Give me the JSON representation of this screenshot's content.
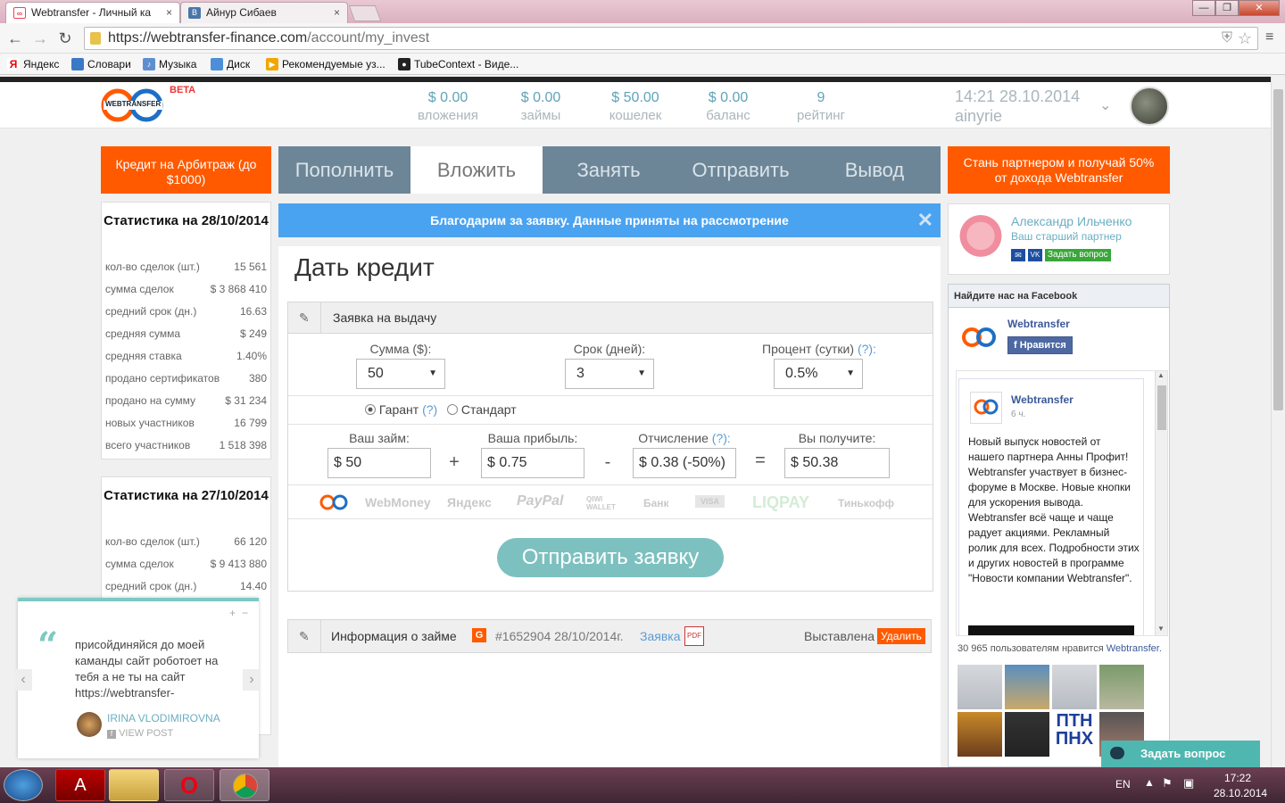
{
  "browser": {
    "tabs": [
      {
        "label": "Webtransfer - Личный ка",
        "close": "×"
      },
      {
        "label": "Айнур Сибаев",
        "close": "×"
      }
    ],
    "url_host": "https://webtransfer-finance.com",
    "url_path": "/account/my_invest",
    "bookmarks": [
      "Яндекс",
      "Словари",
      "Музыка",
      "Диск",
      "Рекомендуемые уз...",
      "TubeContext - Виде..."
    ],
    "window_buttons": [
      "—",
      "❐",
      "✕"
    ]
  },
  "header": {
    "logo_text": "WEBTRANSFER",
    "beta": "BETA",
    "stats": [
      {
        "value": "$ 0.00",
        "label": "вложения"
      },
      {
        "value": "$ 0.00",
        "label": "займы"
      },
      {
        "value": "$ 50.00",
        "label": "кошелек"
      },
      {
        "value": "$ 0.00",
        "label": "баланс"
      },
      {
        "value": "9",
        "label": "рейтинг"
      }
    ],
    "datetime": "14:21 28.10.2014",
    "username": "ainyrie"
  },
  "left": {
    "promo": "Кредит на Арбитраж (до $1000)",
    "stats_1": {
      "title": "Статистика на 28/10/2014",
      "rows": [
        {
          "label": "кол-во сделок (шт.)",
          "value": "15 561"
        },
        {
          "label": "сумма сделок",
          "value": "$ 3 868 410"
        },
        {
          "label": "средний срок (дн.)",
          "value": "16.63"
        },
        {
          "label": "средняя сумма",
          "value": "$ 249"
        },
        {
          "label": "средняя ставка",
          "value": "1.40%"
        },
        {
          "label": "продано сертификатов",
          "value": "380"
        },
        {
          "label": "продано на сумму",
          "value": "$ 31 234"
        },
        {
          "label": "новых участников",
          "value": "16 799"
        },
        {
          "label": "всего участников",
          "value": "1 518 398"
        }
      ]
    },
    "stats_2": {
      "title": "Статистика на 27/10/2014",
      "rows": [
        {
          "label": "кол-во сделок (шт.)",
          "value": "66 120"
        },
        {
          "label": "сумма сделок",
          "value": "$ 9 413 880"
        },
        {
          "label": "средний срок (дн.)",
          "value": "14.40"
        }
      ]
    }
  },
  "nav": {
    "tabs": [
      "Пополнить",
      "Вложить",
      "Занять",
      "Отправить",
      "Вывод"
    ]
  },
  "alert": "Благодарим за заявку. Данные приняты на рассмотрение",
  "form": {
    "title": "Дать кредит",
    "panel_title": "Заявка на выдачу",
    "sum_label": "Сумма ($):",
    "sum_value": "50",
    "term_label": "Срок (дней):",
    "term_value": "3",
    "rate_label": "Процент (сутки)",
    "rate_help": "(?):",
    "rate_value": "0.5%",
    "guarant": "Гарант",
    "guarant_help": "(?)",
    "standard": "Стандарт",
    "loan_label": "Ваш займ:",
    "loan_value": "$ 50",
    "profit_label": "Ваша прибыль:",
    "profit_value": "$ 0.75",
    "fee_label": "Отчисление",
    "fee_help": "(?):",
    "fee_value": "$ 0.38 (-50%)",
    "receive_label": "Вы получите:",
    "receive_value": "$ 50.38",
    "payment_methods": [
      "WebMoney",
      "Яндекс",
      "PayPal",
      "QIWI WALLET",
      "Банк",
      "VISA",
      "LIQPAY",
      "Тинькофф"
    ],
    "submit": "Отправить заявку"
  },
  "loan_info": {
    "title": "Информация о займе",
    "badge": "G",
    "number": "#1652904 28/10/2014г.",
    "link": "Заявка",
    "status": "Выставлена",
    "delete": "Удалить"
  },
  "right": {
    "partner_promo": "Стань партнером и получай 50% от дохода Webtransfer",
    "partner_name": "Александр Ильченко",
    "partner_role": "Ваш старший партнер",
    "ask_question": "Задать вопрос",
    "fb_header": "Найдите нас на Facebook",
    "fb_page": "Webtransfer",
    "fb_like": "Нравится",
    "post_author": "Webtransfer",
    "post_time": "6 ч.",
    "post_text": "Новый выпуск новостей от нашего партнера Анны Профит! Webtransfer участвует в бизнес-форуме в Москве. Новые кнопки для ускорения вывода. Webtransfer всё чаще и чаще радует акциями. Рекламный ролик для всех. Подробности этих и других новостей в программе \"Новости компании Webtransfer\".",
    "likes_text": "30 965 пользователям нравится",
    "likes_link": "Webtransfer."
  },
  "chat_widget": {
    "text": "присойдиняйся до моей каманды сайт роботоет на тебя а не ты на сайт https://webtransfer-",
    "author": "IRINA VLODIMIROVNA",
    "view_post": "VIEW POST",
    "quote": "“"
  },
  "support_button": "Задать вопрос",
  "taskbar": {
    "lang": "EN",
    "time": "17:22",
    "date": "28.10.2014"
  },
  "colors": {
    "orange": "#ff5a00",
    "nav": "#6d8697",
    "alert": "#4aa3f0",
    "teal": "#7dc0c0"
  }
}
